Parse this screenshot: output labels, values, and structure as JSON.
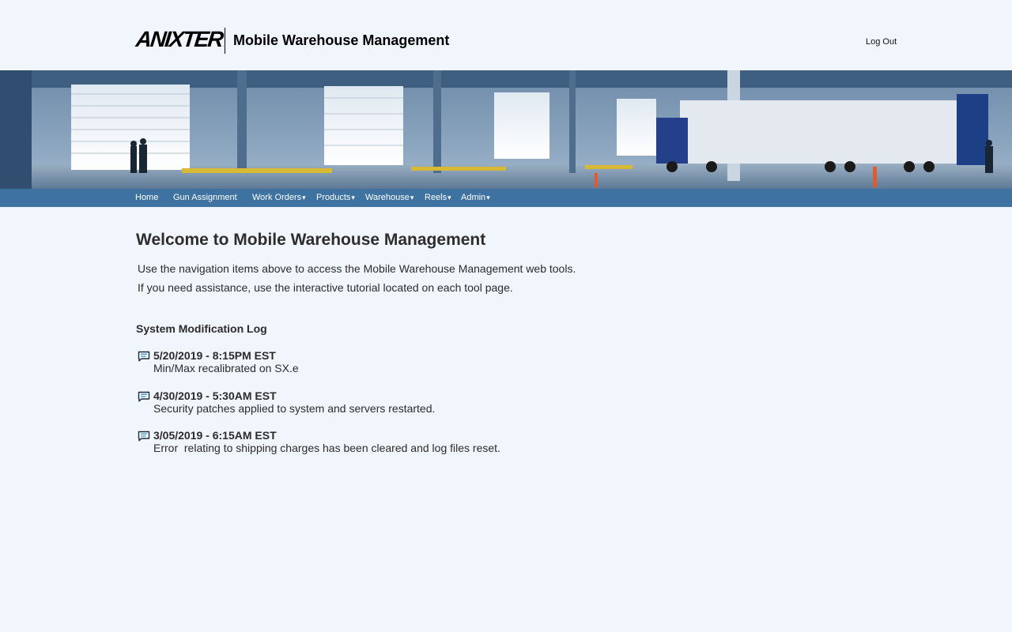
{
  "header": {
    "logo_text": "ANIXTER",
    "logo_reg": ".",
    "app_title": "Mobile Warehouse Management",
    "logout_label": "Log Out"
  },
  "nav": {
    "items": [
      {
        "label": "Home",
        "dropdown": false
      },
      {
        "label": "Gun Assignment",
        "dropdown": false
      },
      {
        "label": "Work Orders",
        "dropdown": true
      },
      {
        "label": "Products",
        "dropdown": true
      },
      {
        "label": "Warehouse",
        "dropdown": true
      },
      {
        "label": "Reels",
        "dropdown": true
      },
      {
        "label": "Admin",
        "dropdown": true
      }
    ],
    "caret": "▾"
  },
  "main": {
    "title": "Welcome to Mobile Warehouse Management",
    "intro_lines": [
      "Use the navigation items above to access the Mobile Warehouse Management web tools.",
      "If you need assistance, use the interactive tutorial located on each tool page."
    ],
    "log_title": "System Modification Log",
    "log_entries": [
      {
        "date": "5/20/2019 - 8:15PM EST",
        "text": "Min/Max recalibrated on SX.e",
        "icon": "message-icon"
      },
      {
        "date": "4/30/2019 - 5:30AM EST",
        "text": "Security patches applied to system and servers restarted.",
        "icon": "message-icon"
      },
      {
        "date": "3/05/2019 - 6:15AM EST",
        "text": "Error  relating to shipping charges has been cleared and log files reset.",
        "icon": "message-icon"
      }
    ]
  },
  "colors": {
    "page_bg": "#f1f6fc",
    "nav_bg": "#3e72a0",
    "nav_text": "#ffffff",
    "icon_accent": "#1e88c8"
  }
}
